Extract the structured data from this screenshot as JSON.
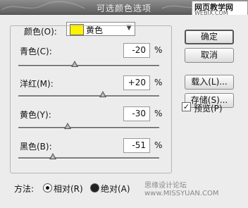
{
  "titlebar": {
    "title": "可选颜色选项"
  },
  "watermark_top": {
    "line1": "网页教学网",
    "line2": "WEBJX.COM"
  },
  "colors_row": {
    "label": "颜色(O):",
    "selected": "黄色",
    "swatch_color": "#fff200"
  },
  "sliders": [
    {
      "label": "青色(C):",
      "value": "-20",
      "unit": "%",
      "level": -20
    },
    {
      "label": "洋红(M):",
      "value": "+20",
      "unit": "%",
      "level": 20
    },
    {
      "label": "黄色(Y):",
      "value": "-30",
      "unit": "%",
      "level": -30
    },
    {
      "label": "黑色(B):",
      "value": "-51",
      "unit": "%",
      "level": -51
    }
  ],
  "buttons": {
    "ok": "确定",
    "cancel": "取消",
    "load": "载入(L)...",
    "save": "存储(S)..."
  },
  "preview": {
    "label": "预览(P)",
    "checked": true,
    "check_glyph": "✓"
  },
  "method": {
    "label": "方法:",
    "relative": "相对(R)",
    "absolute": "绝对(A)"
  },
  "watermark_bottom": "思缘设计论坛 www.MISSYUAN.COM"
}
